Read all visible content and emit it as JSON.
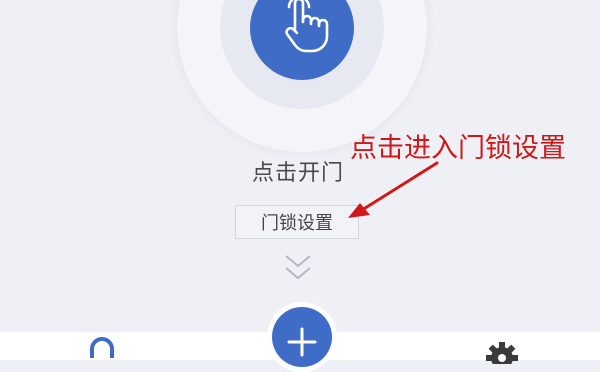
{
  "main": {
    "unlock_label": "点击开门",
    "settings_button": "门锁设置"
  },
  "annotation": {
    "text": "点击进入门锁设置"
  },
  "icons": {
    "unlock": "hand-tap-icon",
    "expand": "double-chevron-down-icon",
    "lock_tab": "lock-icon",
    "add": "plus-icon",
    "settings_tab": "gear-icon"
  },
  "colors": {
    "accent": "#3f6cc6",
    "annotation": "#d01818",
    "background": "#eef0f6"
  }
}
